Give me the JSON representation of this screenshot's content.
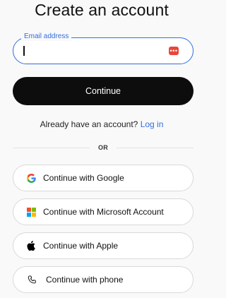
{
  "title": "Create an account",
  "email": {
    "label": "Email address",
    "value": "",
    "password_manager_icon": "password-manager-icon",
    "accent_color": "#2f6fe4"
  },
  "continue_label": "Continue",
  "login_prompt": {
    "text": "Already have an account?",
    "link": "Log in"
  },
  "divider_text": "OR",
  "social": [
    {
      "label": "Continue with Google",
      "icon": "google-icon"
    },
    {
      "label": "Continue with Microsoft Account",
      "icon": "microsoft-icon"
    },
    {
      "label": "Continue with Apple",
      "icon": "apple-icon"
    },
    {
      "label": "Continue with phone",
      "icon": "phone-icon"
    }
  ]
}
